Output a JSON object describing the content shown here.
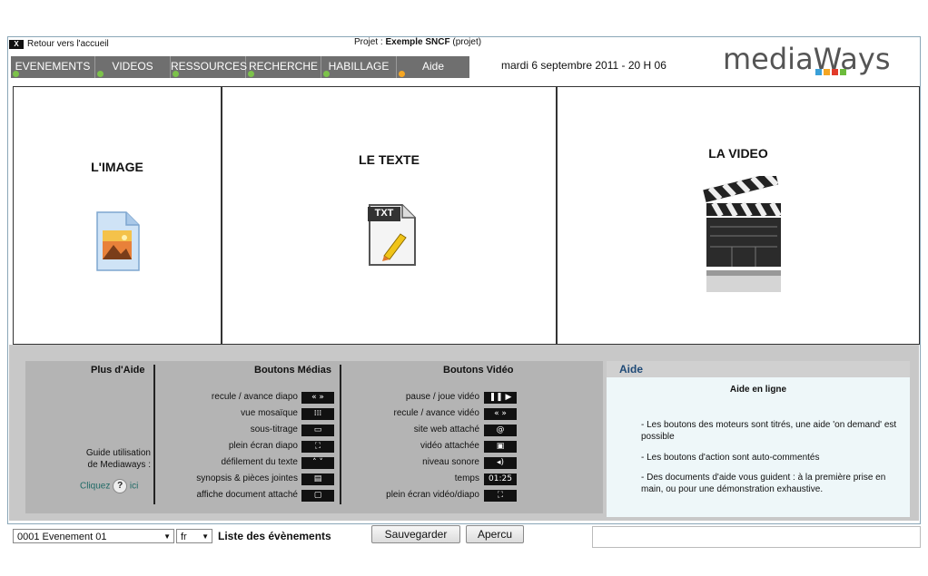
{
  "header": {
    "home_box": "X",
    "home_link": "Retour vers l'accueil",
    "project_prefix": "Projet : ",
    "project_name": "Exemple SNCF",
    "project_suffix": " (projet)",
    "date": "mardi 6 septembre 2011 - 20 H 06",
    "logo_text": "mediaWays"
  },
  "tabs": [
    {
      "label": "EVENEMENTS"
    },
    {
      "label": "VIDEOS"
    },
    {
      "label": "RESSOURCES"
    },
    {
      "label": "RECHERCHE"
    },
    {
      "label": "HABILLAGE"
    },
    {
      "label": "Aide"
    }
  ],
  "panels": {
    "image": {
      "title": "L'IMAGE"
    },
    "text": {
      "title": "LE TEXTE",
      "icon_label": "TXT"
    },
    "video": {
      "title": "LA VIDEO"
    }
  },
  "help": {
    "col1_title": "Plus d'Aide",
    "guide_line1": "Guide utilisation",
    "guide_line2": "de Mediaways :",
    "click_prefix": "Cliquez",
    "click_suffix": "ici",
    "col2_title": "Boutons Médias",
    "media_rows": [
      {
        "label": "recule / avance diapo",
        "icon": "« »"
      },
      {
        "label": "vue mosaïque",
        "icon": "⁞⁞⁞"
      },
      {
        "label": "sous-titrage",
        "icon": "▭"
      },
      {
        "label": "plein écran diapo",
        "icon": "⛶"
      },
      {
        "label": "défilement du texte",
        "icon": "˄ ˅"
      },
      {
        "label": "synopsis & pièces jointes",
        "icon": "▤"
      },
      {
        "label": "affiche document attaché",
        "icon": "▢"
      }
    ],
    "col3_title": "Boutons Vidéo",
    "video_rows": [
      {
        "label": "pause / joue vidéo",
        "icon": "❚❚ ▶"
      },
      {
        "label": "recule / avance vidéo",
        "icon": "« »"
      },
      {
        "label": "site web attaché",
        "icon": "@"
      },
      {
        "label": "vidéo attachée",
        "icon": "▣"
      },
      {
        "label": "niveau sonore",
        "icon": "◂)"
      },
      {
        "label": "temps",
        "icon": "01:25"
      },
      {
        "label": "plein écran vidéo/diapo",
        "icon": "⛶"
      }
    ],
    "aide_header": "Aide",
    "aide_title": "Aide en ligne",
    "aide_p1": "- Les boutons des moteurs sont titrés, une aide 'on demand' est possible",
    "aide_p2": "- Les boutons d'action sont auto-commentés",
    "aide_p3": "- Des documents d'aide vous guident : à la première prise en main, ou pour une démonstration exhaustive."
  },
  "bottom": {
    "event_select": "0001 Evenement 01",
    "lang_select": "fr",
    "events_label": "Liste des évènements",
    "save_button": "Sauvegarder",
    "preview_button": "Apercu"
  },
  "colors": {
    "tab_bg": "#6f6f6f",
    "tab_dot_green": "#7cc24a",
    "tab_dot_orange": "#f5a623",
    "aide_header_text": "#1f4a77",
    "logo_squares": [
      "#3aa0d8",
      "#f5a623",
      "#e23a2a",
      "#6cbb3c"
    ]
  }
}
